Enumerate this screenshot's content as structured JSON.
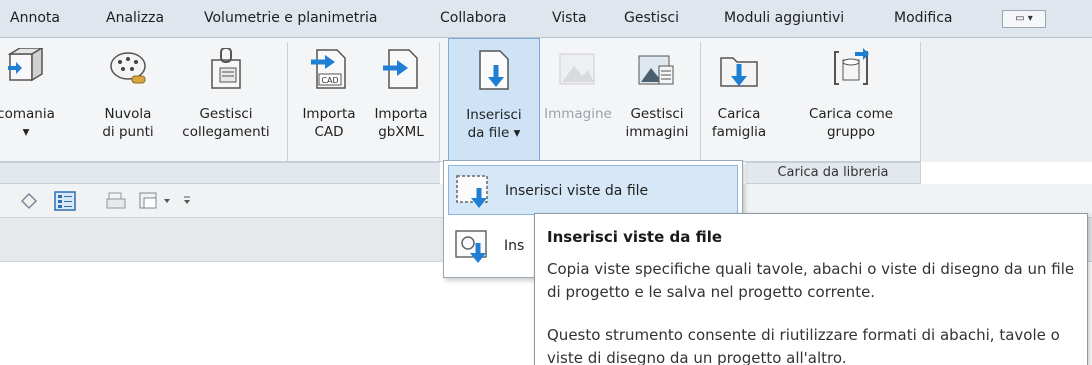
{
  "menu_tabs": [
    "Annota",
    "Analizza",
    "Volumetrie e planimetria",
    "Collabora",
    "Vista",
    "Gestisci",
    "Moduli aggiuntivi",
    "Modifica"
  ],
  "tab_dropdown_glyph": "▭ ▾",
  "ribbon": {
    "buttons": [
      {
        "label1": "comania",
        "label2": "▾",
        "icon": "decal-icon"
      },
      {
        "label1": "Nuvola",
        "label2": "di punti",
        "icon": "point-cloud-icon"
      },
      {
        "label1": "Gestisci",
        "label2": "collegamenti",
        "icon": "manage-links-icon"
      },
      {
        "label1": "Importa",
        "label2": "CAD",
        "icon": "import-cad-icon",
        "badge": "CAD"
      },
      {
        "label1": "Importa",
        "label2": "gbXML",
        "icon": "import-gbxml-icon"
      },
      {
        "label1": "Inserisci",
        "label2": "da file ▾",
        "icon": "insert-from-file-icon"
      },
      {
        "label1": "Immagine",
        "label2": "",
        "icon": "image-icon"
      },
      {
        "label1": "Gestisci",
        "label2": "immagini",
        "icon": "manage-images-icon"
      },
      {
        "label1": "Carica",
        "label2": "famiglia",
        "icon": "load-family-icon"
      },
      {
        "label1": "Carica come",
        "label2": "gruppo",
        "icon": "load-as-group-icon"
      }
    ],
    "panel_label_library": "Carica da libreria"
  },
  "dropdown_menu": {
    "items": [
      {
        "label": "Inserisci viste da file",
        "icon": "insert-views-icon"
      },
      {
        "label": "Ins",
        "icon": "insert-2d-elements-icon"
      }
    ]
  },
  "tooltip": {
    "title": "Inserisci viste da file",
    "body": "Copia viste specifiche quali tavole, abachi o viste di disegno da un file di progetto e le salva nel progetto corrente.",
    "extra": "Questo strumento consente di riutilizzare formati di abachi, tavole o viste di disegno da un progetto all'altro."
  },
  "colors": {
    "active_button_bg": "#cfe3f6",
    "active_border": "#7fa9d6",
    "arrow_blue": "#1f7fd4",
    "tab_bar_bg": "#dfe6ee"
  }
}
